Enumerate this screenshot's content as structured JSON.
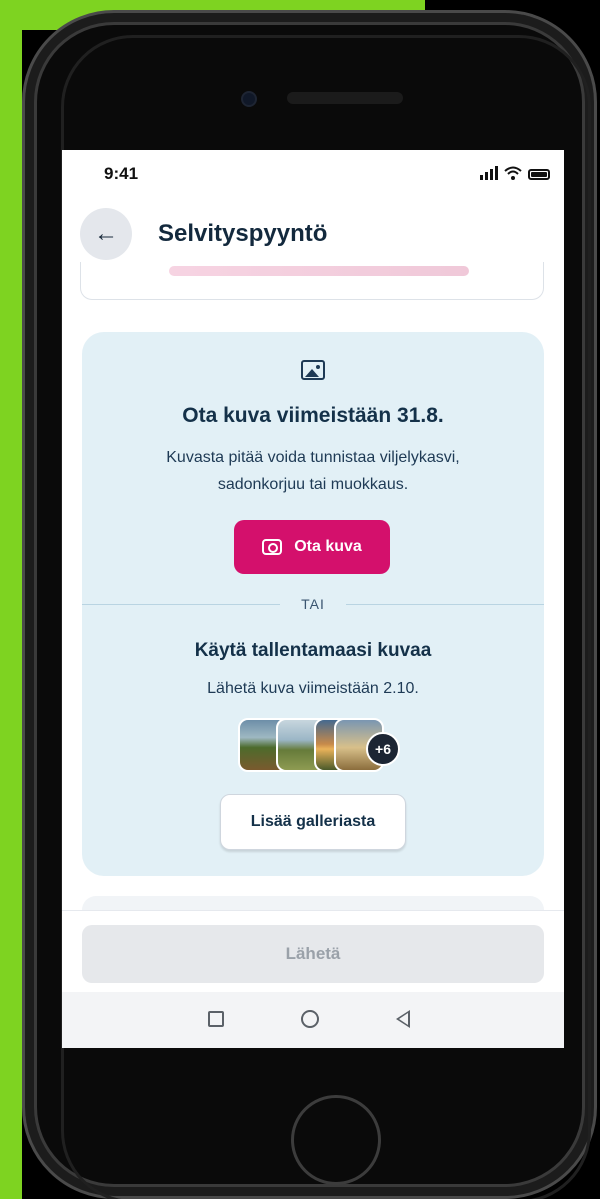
{
  "status_bar": {
    "time": "9:41"
  },
  "header": {
    "back_icon": "←",
    "title": "Selvityspyyntö"
  },
  "upload_card": {
    "title": "Ota kuva viimeistään 31.8.",
    "description": "Kuvasta pitää voida tunnistaa viljelykasvi, sadonkorjuu tai muokkaus.",
    "take_photo_label": "Ota kuva",
    "divider_label": "TAI",
    "gallery_section_title": "Käytä tallentamaasi kuvaa",
    "gallery_section_desc": "Lähetä kuva viimeistään 2.10.",
    "more_count": "+6",
    "gallery_button_label": "Lisää galleriasta"
  },
  "footer": {
    "send_label": "Lähetä"
  },
  "colors": {
    "accent": "#d4106c",
    "card_bg": "#e2f0f6",
    "title_text": "#143149",
    "disabled_button": "#e6e8eb"
  },
  "icons": [
    "arrow-left-icon",
    "image-icon",
    "camera-icon",
    "signal-icon",
    "wifi-icon",
    "battery-icon",
    "nav-recents-icon",
    "nav-home-icon",
    "nav-back-icon"
  ]
}
